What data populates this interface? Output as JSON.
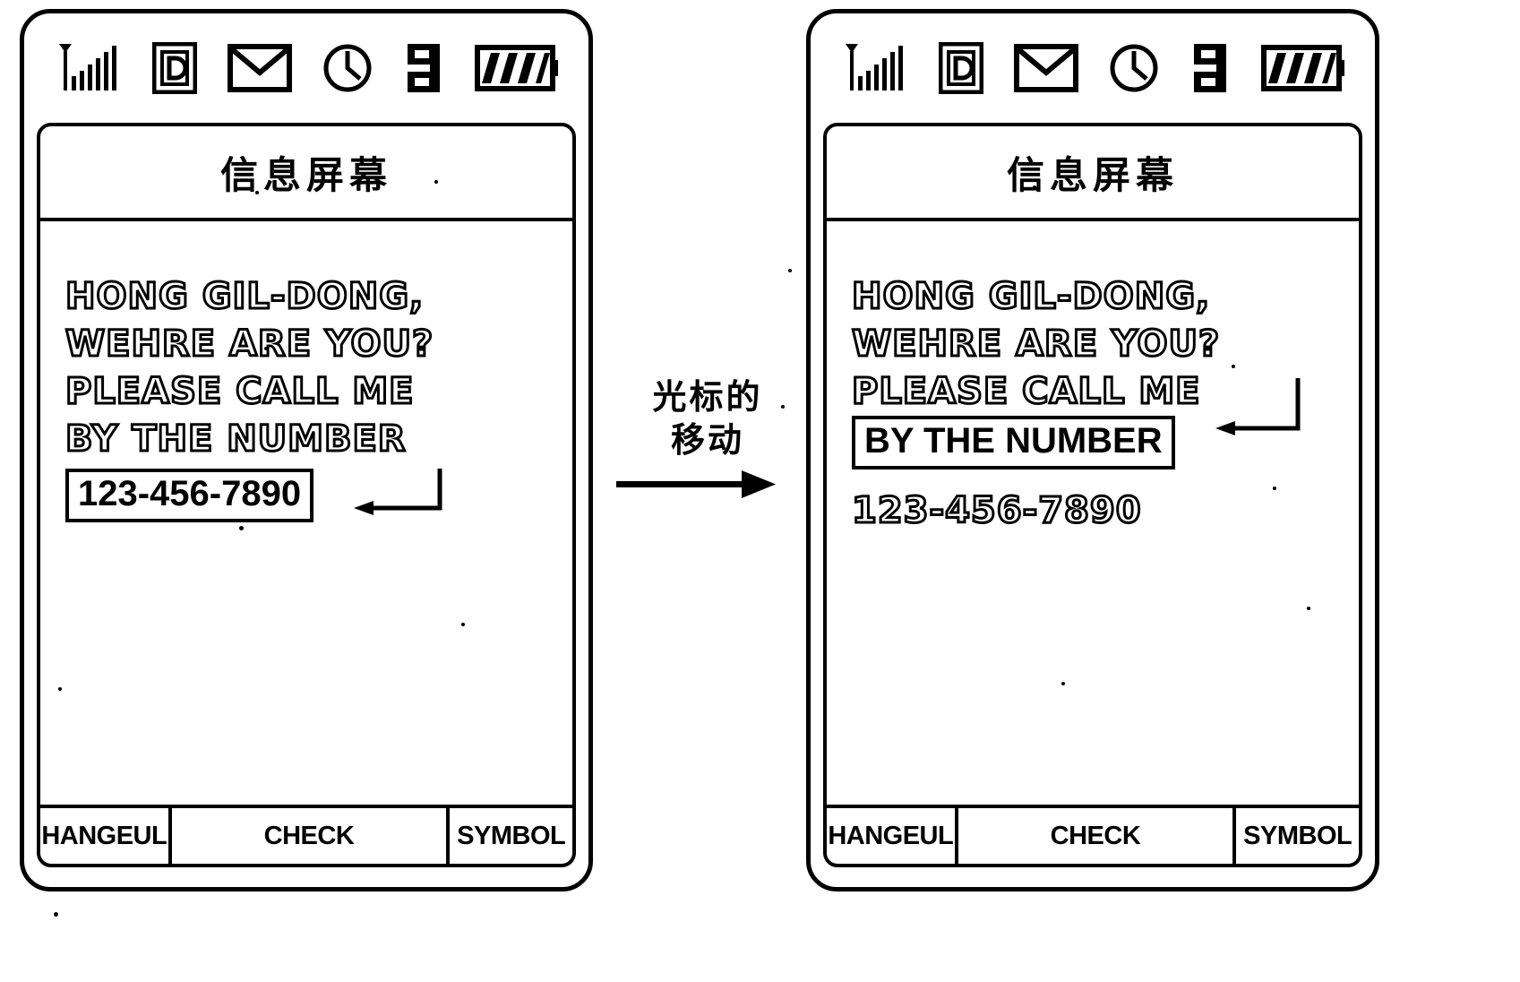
{
  "figure": {
    "type": "patent-diagram",
    "description": "Two mobile phone message screens showing cursor movement"
  },
  "transition": {
    "line1": "光标的",
    "line2": "移动",
    "arrow": "right-arrow"
  },
  "statusbar": {
    "icons": [
      {
        "name": "signal-antenna-icon",
        "label": "signal"
      },
      {
        "name": "data-d-icon",
        "label": "data"
      },
      {
        "name": "envelope-message-icon",
        "label": "message"
      },
      {
        "name": "clock-icon",
        "label": "clock"
      },
      {
        "name": "memory-card-icon",
        "label": "memory"
      },
      {
        "name": "battery-icon",
        "label": "battery"
      }
    ]
  },
  "phone_left": {
    "title": "信息屏幕",
    "message_lines": [
      "HONG GIL-DONG,",
      "WEHRE ARE YOU?",
      "PLEASE CALL ME",
      "BY THE NUMBER"
    ],
    "phone_number": "123-456-7890",
    "selected_element": "phone-number",
    "softkeys": [
      {
        "label": "HANGEUL"
      },
      {
        "label": "CHECK"
      },
      {
        "label": "SYMBOL"
      }
    ]
  },
  "phone_right": {
    "title": "信息屏幕",
    "message_lines": [
      "HONG GIL-DONG,",
      "WEHRE ARE YOU?",
      "PLEASE CALL ME",
      "BY THE NUMBER"
    ],
    "phone_number": "123-456-7890",
    "selected_element": "by-the-number-line",
    "softkeys": [
      {
        "label": "HANGEUL"
      },
      {
        "label": "CHECK"
      },
      {
        "label": "SYMBOL"
      }
    ]
  },
  "colors": {
    "ink": "#000000",
    "paper": "#ffffff"
  }
}
